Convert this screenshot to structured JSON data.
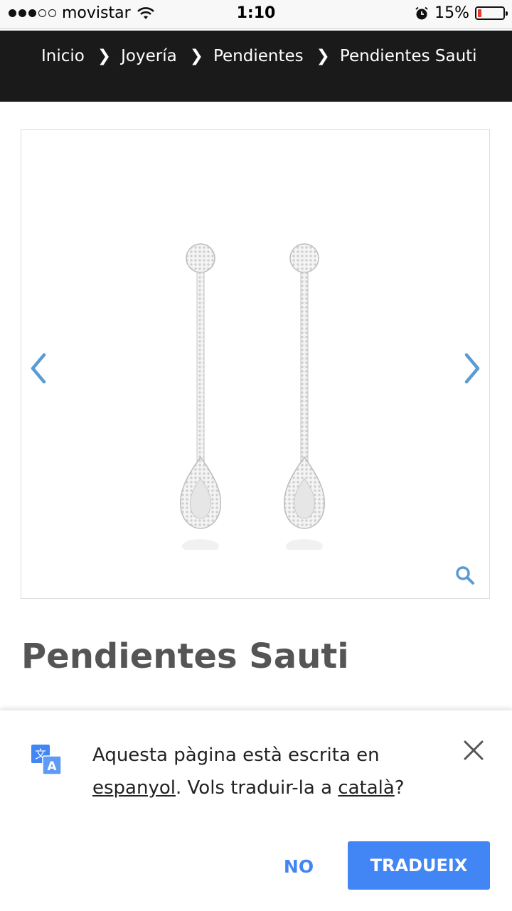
{
  "status_bar": {
    "carrier": "movistar",
    "time": "1:10",
    "battery": "15%",
    "battery_level": 0.15
  },
  "breadcrumb": {
    "items": [
      "Inicio",
      "Joyería",
      "Pendientes",
      "Pendientes Sauti"
    ],
    "separator": "❯"
  },
  "product": {
    "title": "Pendientes Sauti",
    "image": "earrings-image"
  },
  "translate_bar": {
    "message_prefix": "Aquesta pàgina està escrita en ",
    "source_language": "espanyol",
    "message_middle": ". Vols traduir-la a ",
    "target_language": "català",
    "message_suffix": "?",
    "no_label": "NO",
    "translate_label": "TRADUEIX",
    "accent_color": "#4285f4"
  }
}
